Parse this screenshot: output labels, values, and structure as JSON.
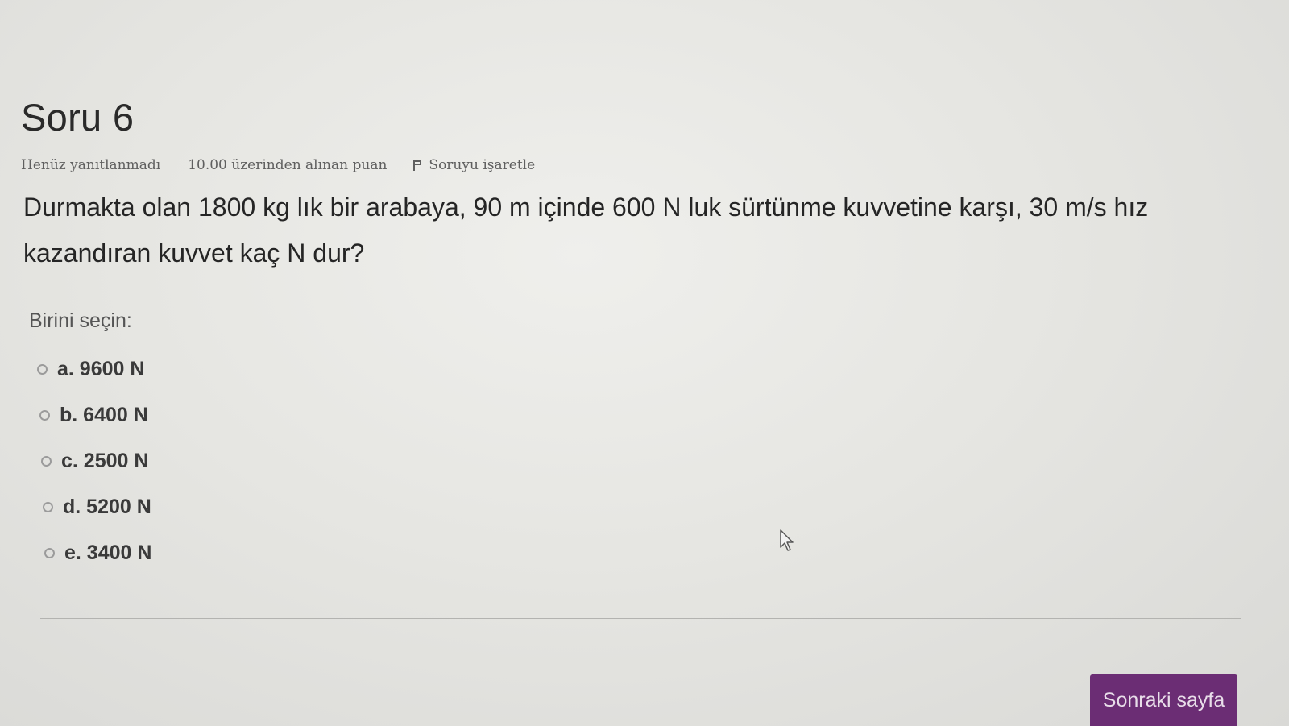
{
  "question": {
    "title": "Soru 6",
    "state": "Henüz yanıtlanmadı",
    "grade": "10.00 üzerinden alınan puan",
    "flag_label": "Soruyu işaretle",
    "text": "Durmakta olan 1800 kg lık bir arabaya, 90 m içinde 600 N luk sürtünme kuvvetine karşı, 30 m/s hız kazandıran kuvvet kaç N dur?"
  },
  "answers": {
    "prompt": "Birini seçin:",
    "options": [
      {
        "label": "a. 9600 N",
        "selected": false
      },
      {
        "label": "b. 6400 N",
        "selected": false
      },
      {
        "label": "c. 2500 N",
        "selected": false
      },
      {
        "label": "d. 5200 N",
        "selected": false
      },
      {
        "label": "e. 3400 N",
        "selected": false
      }
    ]
  },
  "navigation": {
    "next_label": "Sonraki sayfa",
    "next_color": "#6b2d74"
  },
  "icons": {
    "flag": "flag-icon",
    "cursor": "mouse-pointer-icon"
  }
}
